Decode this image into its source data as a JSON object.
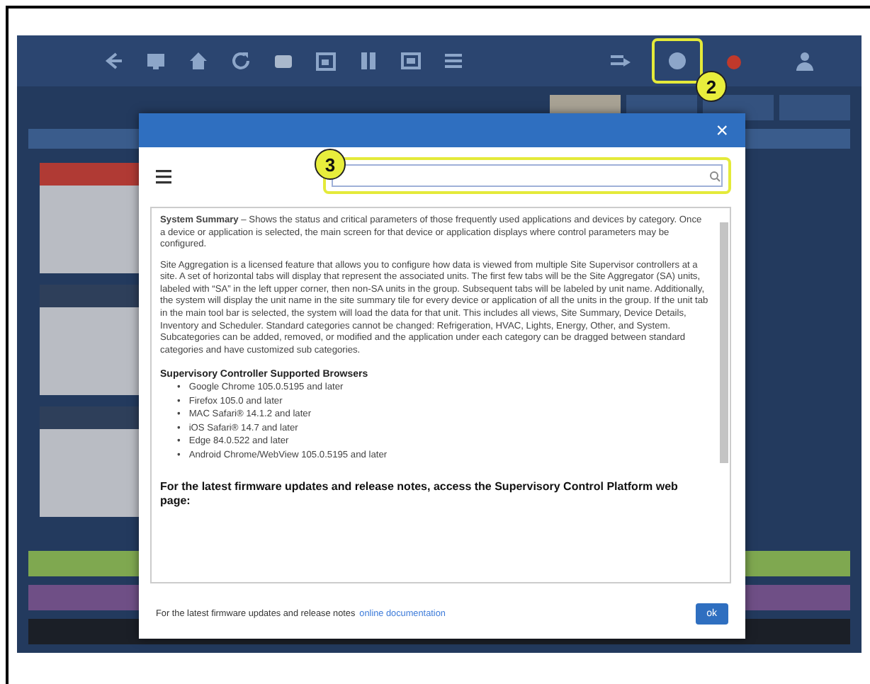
{
  "toolbar_tabs": [
    {
      "selected": true
    },
    {
      "selected": false
    },
    {
      "selected": false
    },
    {
      "selected": false
    }
  ],
  "callouts": [
    {
      "label": "2"
    },
    {
      "label": "3"
    }
  ],
  "modal": {
    "close": "×",
    "paragraphs": [
      "**System Summary** – Shows the status and critical parameters of those frequently used applications and devices by category. Once a device or application is selected, the main screen for that device or application displays where control parameters may be configured.",
      "Site Aggregation is a licensed feature that allows you to configure how data is viewed from multiple Site Supervisor controllers at a site. A set of horizontal tabs will display that represent the associated units. The first few tabs will be the Site Aggregator (SA) units, labeled with “SA” in the left upper corner, then non-SA units in the group. Subsequent tabs will be labeled by unit name. Additionally, the system will display the unit name in the site summary tile for every device or application of all the units in the group. If the unit tab in the main tool bar is selected, the system will load the data for that unit. This includes all views, Site Summary, Device Details, Inventory and Scheduler. Standard categories cannot be changed: Refrigeration, HVAC, Lights, Energy, Other, and System. Subcategories can be added, removed, or modified and the application under each category can be dragged between standard categories and have customized sub categories."
    ],
    "browsers_heading": "Supervisory Controller Supported Browsers",
    "browsers": [
      {
        "marker": "•",
        "text": "Google Chrome 105.0.5195 and later"
      },
      {
        "marker": "•",
        "text": "Firefox 105.0 and later"
      },
      {
        "marker": "•",
        "text": "MAC Safari® 14.1.2 and later"
      },
      {
        "marker": "•",
        "text": "iOS Safari® 14.7 and later"
      },
      {
        "marker": "•",
        "text": "Edge 84.0.522 and later"
      },
      {
        "marker": "•",
        "text": "Android Chrome/WebView 105.0.5195 and later"
      }
    ],
    "firmware_note": "For the latest firmware updates and release notes, access the Supervisory Control Platform web page:",
    "footer_text": "For the latest firmware updates and release notes",
    "footer_link": "online documentation",
    "ok_button": "ok"
  }
}
